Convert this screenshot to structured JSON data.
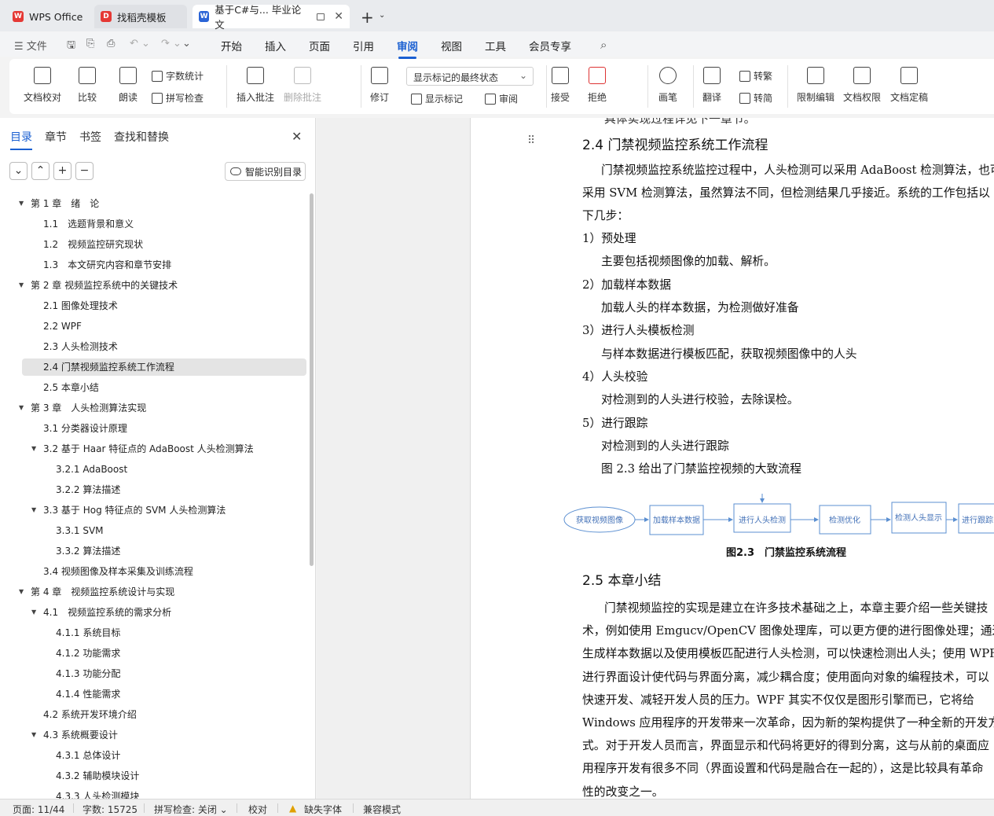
{
  "tabs": [
    {
      "label": "WPS Office",
      "icon": "wps-logo-icon"
    },
    {
      "label": "找稻壳模板",
      "icon": "docer-icon"
    },
    {
      "label": "基于C#与... 毕业论文",
      "icon": "word-doc-icon"
    }
  ],
  "menu": {
    "file": "文件",
    "items": [
      "开始",
      "插入",
      "页面",
      "引用",
      "审阅",
      "视图",
      "工具",
      "会员专享"
    ],
    "active": "审阅"
  },
  "ribbon": {
    "doc_check": "文档校对",
    "compare": "比较",
    "read_aloud": "朗读",
    "word_count": "字数统计",
    "spell_check": "拼写检查",
    "insert_comment": "插入批注",
    "delete_comment": "删除批注",
    "revise": "修订",
    "markup_dropdown": "显示标记的最终状态",
    "show_markup": "显示标记",
    "review": "审阅",
    "accept": "接受",
    "reject": "拒绝",
    "pen": "画笔",
    "translate": "翻译",
    "to_traditional": "转繁",
    "to_simplified": "转简",
    "restrict_edit": "限制编辑",
    "doc_permission": "文档权限",
    "finalize": "文档定稿"
  },
  "nav": {
    "tabs": [
      "目录",
      "章节",
      "书签",
      "查找和替换"
    ],
    "active_tab": "目录",
    "smart_toc": "智能识别目录",
    "toc": [
      {
        "text": "第 1 章　绪　论",
        "level": 0,
        "expanded": true
      },
      {
        "text": "1.1　选题背景和意义",
        "level": 1
      },
      {
        "text": "1.2　视频监控研究现状",
        "level": 1
      },
      {
        "text": "1.3　本文研究内容和章节安排",
        "level": 1
      },
      {
        "text": "第 2 章  视频监控系统中的关键技术",
        "level": 0,
        "expanded": true
      },
      {
        "text": "2.1 图像处理技术",
        "level": 1
      },
      {
        "text": "2.2 WPF",
        "level": 1
      },
      {
        "text": "2.3  人头检测技术",
        "level": 1
      },
      {
        "text": "2.4  门禁视频监控系统工作流程",
        "level": 1,
        "selected": true
      },
      {
        "text": "2.5  本章小结",
        "level": 1
      },
      {
        "text": "第 3 章　人头检测算法实现",
        "level": 0,
        "expanded": true
      },
      {
        "text": "3.1  分类器设计原理",
        "level": 1
      },
      {
        "text": "3.2  基于 Haar 特征点的 AdaBoost 人头检测算法",
        "level": 1,
        "expanded": true
      },
      {
        "text": "3.2.1 AdaBoost",
        "level": 2
      },
      {
        "text": "3.2.2  算法描述",
        "level": 2
      },
      {
        "text": "3.3  基于 Hog 特征点的 SVM 人头检测算法",
        "level": 1,
        "expanded": true
      },
      {
        "text": "3.3.1 SVM",
        "level": 2
      },
      {
        "text": "3.3.2  算法描述",
        "level": 2
      },
      {
        "text": "3.4  视频图像及样本采集及训练流程",
        "level": 1
      },
      {
        "text": "第 4 章　视频监控系统设计与实现",
        "level": 0,
        "expanded": true
      },
      {
        "text": "4.1　视频监控系统的需求分析",
        "level": 1,
        "expanded": true
      },
      {
        "text": "4.1.1  系统目标",
        "level": 2
      },
      {
        "text": "4.1.2  功能需求",
        "level": 2
      },
      {
        "text": "4.1.3  功能分配",
        "level": 2
      },
      {
        "text": "4.1.4  性能需求",
        "level": 2
      },
      {
        "text": "4.2  系统开发环境介绍",
        "level": 1
      },
      {
        "text": "4.3 系统概要设计",
        "level": 1,
        "expanded": true
      },
      {
        "text": "4.3.1  总体设计",
        "level": 2
      },
      {
        "text": "4.3.2  辅助模块设计",
        "level": 2
      },
      {
        "text": "4.3.3  人头检测模块",
        "level": 2
      }
    ]
  },
  "doc": {
    "clipped_top": "具体实现过程详见下一章节。",
    "h24": "2.4  门禁视频监控系统工作流程",
    "lines": [
      "门禁视频监控系统监控过程中，人头检测可以采用 AdaBoost 检测算法，也可以",
      "采用 SVM 检测算法，虽然算法不同，但检测结果几乎接近。系统的工作包括以",
      "下几步：",
      "1）预处理",
      "主要包括视频图像的加载、解析。",
      "2）加载样本数据",
      "加载人头的样本数据，为检测做好准备",
      "3）进行人头模板检测",
      "与样本数据进行模板匹配，获取视频图像中的人头",
      "4）人头校验",
      "对检测到的人头进行校验，去除误检。",
      "5）进行跟踪",
      "对检测到的人头进行跟踪",
      "图 2.3 给出了门禁监控视频的大致流程"
    ],
    "flow": [
      "获取视频图像",
      "加载样本数据",
      "进行人头检测",
      "检测优化",
      "检测人头显示",
      "进行跟踪"
    ],
    "fig_caption": "图2.3　门禁监控系统流程",
    "h25": "2.5  本章小结",
    "para25": [
      "门禁视频监控的实现是建立在许多技术基础之上，本章主要介绍一些关键技",
      "术，例如使用 Emgucv/OpenCV 图像处理库，可以更方便的进行图像处理；通过",
      "生成样本数据以及使用模板匹配进行人头检测，可以快速检测出人头；使用 WPF",
      "进行界面设计使代码与界面分离，减少耦合度；使用面向对象的编程技术，可以",
      "快速开发、减轻开发人员的压力。WPF 其实不仅仅是图形引擎而已，它将给",
      "Windows 应用程序的开发带来一次革命，因为新的架构提供了一种全新的开发方",
      "式。对于开发人员而言，界面显示和代码将更好的得到分离，这与从前的桌面应",
      "用程序开发有很多不同（界面设置和代码是融合在一起的），这是比较具有革命",
      "性的改变之一。"
    ]
  },
  "status": {
    "page": "页面: 11/44",
    "words": "字数: 15725",
    "spell": "拼写检查: 关闭",
    "proof": "校对",
    "missing_font": "缺失字体",
    "compat": "兼容模式"
  }
}
